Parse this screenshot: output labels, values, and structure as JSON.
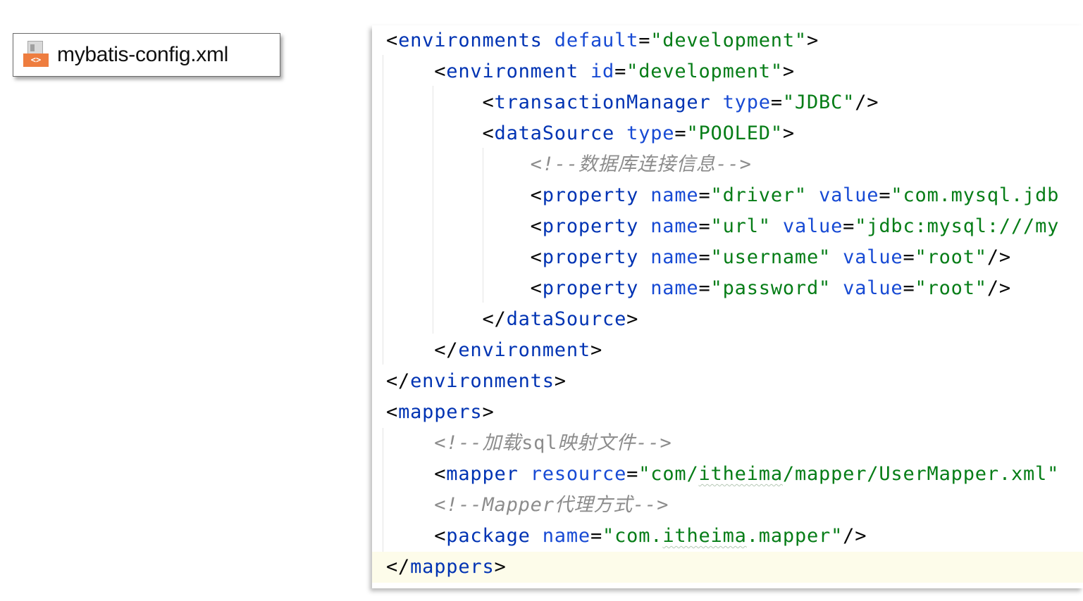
{
  "file": {
    "icon": "xml-file-icon",
    "icon_text": "<>",
    "name": "mybatis-config.xml"
  },
  "editor": {
    "lines": {
      "l1": {
        "open": "<",
        "tag": "environments",
        "a1": "default",
        "eq1": "=",
        "v1": "\"development\"",
        "close": ">"
      },
      "l2": {
        "open": "<",
        "tag": "environment",
        "a1": "id",
        "eq1": "=",
        "v1": "\"development\"",
        "close": ">"
      },
      "l3": {
        "open": "<",
        "tag": "transactionManager",
        "a1": "type",
        "eq1": "=",
        "v1": "\"JDBC\"",
        "close": "/>"
      },
      "l4": {
        "open": "<",
        "tag": "dataSource",
        "a1": "type",
        "eq1": "=",
        "v1": "\"POOLED\"",
        "close": ">"
      },
      "l5": {
        "comment": "<!--数据库连接信息-->"
      },
      "l6": {
        "open": "<",
        "tag": "property",
        "a1": "name",
        "eq1": "=",
        "v1": "\"driver\"",
        "a2": "value",
        "eq2": "=",
        "v2": "\"com.mysql.jdb"
      },
      "l7": {
        "open": "<",
        "tag": "property",
        "a1": "name",
        "eq1": "=",
        "v1": "\"url\"",
        "a2": "value",
        "eq2": "=",
        "v2": "\"jdbc:mysql:///my"
      },
      "l8": {
        "open": "<",
        "tag": "property",
        "a1": "name",
        "eq1": "=",
        "v1": "\"username\"",
        "a2": "value",
        "eq2": "=",
        "v2": "\"root\"",
        "close": "/>"
      },
      "l9": {
        "open": "<",
        "tag": "property",
        "a1": "name",
        "eq1": "=",
        "v1": "\"password\"",
        "a2": "value",
        "eq2": "=",
        "v2": "\"root\"",
        "close": "/>"
      },
      "l10": {
        "open": "</",
        "tag": "dataSource",
        "close": ">"
      },
      "l11": {
        "open": "</",
        "tag": "environment",
        "close": ">"
      },
      "l12": {
        "open": "</",
        "tag": "environments",
        "close": ">"
      },
      "l13": {
        "open": "<",
        "tag": "mappers",
        "close": ">"
      },
      "l14": {
        "comment_a": "<!--加载",
        "comment_b": "sql",
        "comment_c": "映射文件-->"
      },
      "l15": {
        "open": "<",
        "tag": "mapper",
        "a1": "resource",
        "eq1": "=",
        "v1a": "\"com/",
        "v1b": "itheima",
        "v1c": "/mapper/UserMapper.xml\""
      },
      "l16": {
        "comment": "<!--Mapper代理方式-->"
      },
      "l17": {
        "open": "<",
        "tag": "package",
        "a1": "name",
        "eq1": "=",
        "v1a": "\"com.",
        "v1b": "itheima",
        "v1c": ".mapper\"",
        "close": "/>"
      },
      "l18": {
        "open": "</",
        "tag": "mappers",
        "close": ">"
      }
    }
  }
}
